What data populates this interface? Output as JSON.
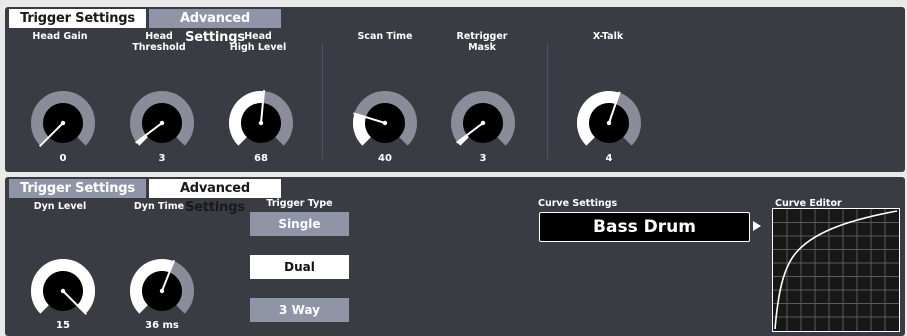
{
  "panel1": {
    "tabs": [
      {
        "label": "Trigger Settings",
        "active": true
      },
      {
        "label": "Advanced Settings",
        "active": false
      }
    ],
    "knobs": [
      {
        "id": "head-gain",
        "label": "Head Gain",
        "value": "0",
        "level": 0.0
      },
      {
        "id": "head-threshold",
        "label": "Head\nThreshold",
        "value": "3",
        "level": 0.03
      },
      {
        "id": "head-high-level",
        "label": "Head\nHigh Level",
        "value": "68",
        "level": 0.52
      },
      {
        "id": "scan-time",
        "label": "Scan Time",
        "value": "40",
        "level": 0.23
      },
      {
        "id": "retrigger-mask",
        "label": "Retrigger\nMask",
        "value": "3",
        "level": 0.03
      },
      {
        "id": "x-talk",
        "label": "X-Talk",
        "value": "4",
        "level": 0.57
      }
    ]
  },
  "panel2": {
    "tabs": [
      {
        "label": "Trigger Settings",
        "active": false
      },
      {
        "label": "Advanced Settings",
        "active": true
      }
    ],
    "knobs": [
      {
        "id": "dyn-level",
        "label": "Dyn Level",
        "value": "15",
        "level": 1.0
      },
      {
        "id": "dyn-time",
        "label": "Dyn Time",
        "value": "36 ms",
        "level": 0.58
      }
    ],
    "trigger_type": {
      "label": "Trigger Type",
      "options": [
        "Single",
        "Dual",
        "3 Way"
      ],
      "selected": "Dual"
    },
    "curve_settings": {
      "label": "Curve Settings",
      "value": "Bass Drum"
    },
    "curve_editor": {
      "label": "Curve Editor"
    }
  },
  "colors": {
    "panel_bg": "#3a3c43",
    "knob_track": "#8a8d99",
    "knob_fill": "#ffffff",
    "knob_center": "#000000",
    "inactive_tab": "#9094a7"
  }
}
